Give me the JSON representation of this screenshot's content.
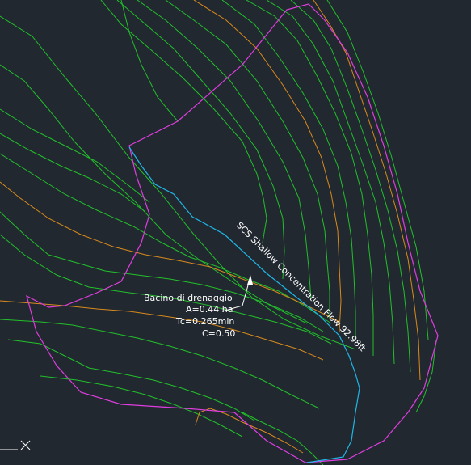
{
  "drawing": {
    "colors": {
      "background": "#212830",
      "minor_contour": "#22c02a",
      "major_contour": "#d98a1c",
      "basin_boundary": "#e03ee0",
      "flow_path": "#1fb6e6",
      "annotation_text": "#ffffff"
    },
    "flow_label": "SCS Shallow Concentration Flow 92.98ft",
    "basin_label": {
      "name": "Bacino di drenaggio",
      "area": "A=0.44 ha",
      "tc": "Tc=0.265min",
      "coefficient": "C=0.50"
    },
    "icons": {
      "ucs": "ucs-axis-icon",
      "leader_arrow": "leader-arrow-icon"
    }
  }
}
